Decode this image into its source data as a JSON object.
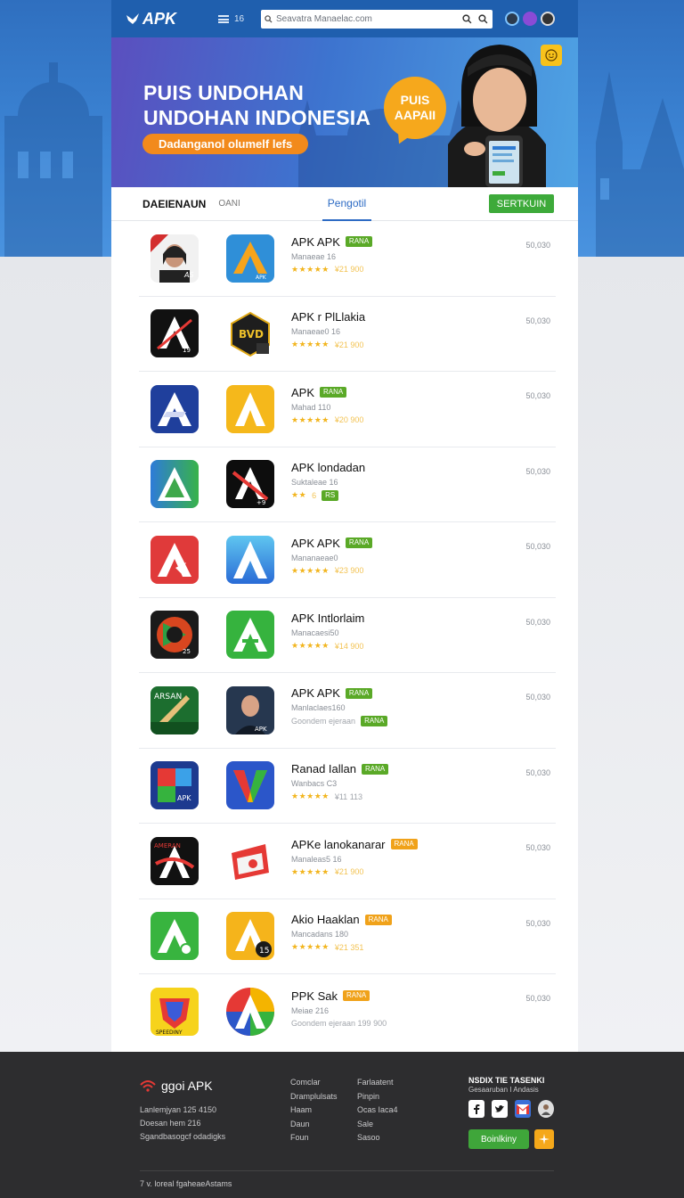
{
  "header": {
    "logo": "APK",
    "menu_label": "16",
    "search_placeholder": "Seavatra Manaelac.com"
  },
  "hero": {
    "title_line1": "PUIS UNDOHAN",
    "title_line2": "UNDOHAN INDONESIA",
    "cta": "Dadanganol olumelf lefs",
    "bubble_line1": "PUIS",
    "bubble_line2": "AAPAII"
  },
  "tabs": {
    "tab1": "DAEIENAUN",
    "tab2": "OANI",
    "active": "Pengotil",
    "action": "SERTKUIN"
  },
  "apps": [
    {
      "name": "APK APK",
      "tag": "RANA",
      "sub": "Manaeae 16",
      "rating_text": "¥21 900",
      "size": "50,030"
    },
    {
      "name": "APK r PlLlakia",
      "tag": "",
      "sub": "Manaeae0 16",
      "rating_text": "¥21 900",
      "size": "50,030"
    },
    {
      "name": "APK",
      "tag": "RANA",
      "sub": "Mahad 110",
      "rating_text": "¥20 900",
      "size": "50,030"
    },
    {
      "name": "APK londadan",
      "tag": "",
      "sub": "Suktaleae 16",
      "rating_text": "6",
      "size": "50,030"
    },
    {
      "name": "APK APK",
      "tag": "RANA",
      "sub": "Mananaeae0",
      "rating_text": "¥23 900",
      "size": "50,030"
    },
    {
      "name": "APK Intlorlaim",
      "tag": "",
      "sub": "Manacaesi50",
      "rating_text": "¥14 900",
      "size": "50,030"
    },
    {
      "name": "APK APK",
      "tag": "RANA",
      "sub": "Manlaclaes160",
      "rating_text": "Goondem ejeraan",
      "size": "50,030"
    },
    {
      "name": "Ranad Iallan",
      "tag": "RANA",
      "sub": "Wanbacs C3",
      "rating_text": "¥11 113",
      "size": "50,030"
    },
    {
      "name": "APKe lanokanarar",
      "tag": "RANA",
      "sub": "Manaleas5 16",
      "rating_text": "¥21 900",
      "size": "50,030"
    },
    {
      "name": "Akio Haaklan",
      "tag": "RANA",
      "sub": "Mancadans 180",
      "rating_text": "¥21 351",
      "size": "50,030"
    },
    {
      "name": "PPK Sak",
      "tag": "RANA",
      "sub": "Meiae 216",
      "rating_text": "Goondem ejeraan 199 900",
      "size": "50,030"
    }
  ],
  "footer": {
    "brand": "ggoi APK",
    "lines": [
      "Lanlemjyan 125 4150",
      "Doesan hem 216",
      "Sgandbasogcf odadigks"
    ],
    "col1": [
      "Comclar",
      "Dramplulsats",
      "Haam",
      "Daun",
      "Foun"
    ],
    "col2": [
      "Farlaatent",
      "Pinpin",
      "Ocas Iaca4",
      "Sale",
      "Sasoo"
    ],
    "social_title": "NSDIX TIE TASENKI",
    "social_sub": "Gesaaruban I Andasis",
    "button": "Boinlkiny",
    "copyright": "7 v. loreal fgaheaeAstams"
  },
  "colors": {
    "header_bg": "#1f5fae",
    "accent_green": "#3daa3a",
    "accent_orange": "#f28a1c",
    "star": "#f2b51e",
    "footer_bg": "#2d2d2f"
  },
  "icons": {
    "logo": "apk-wing-logo-icon",
    "menu": "hamburger-icon",
    "search": "search-icon",
    "avatar": "avatar-icon",
    "footer_logo": "wifi-logo-icon",
    "social": [
      "facebook-icon",
      "twitter-icon",
      "gmail-icon",
      "avatar-icon"
    ]
  }
}
